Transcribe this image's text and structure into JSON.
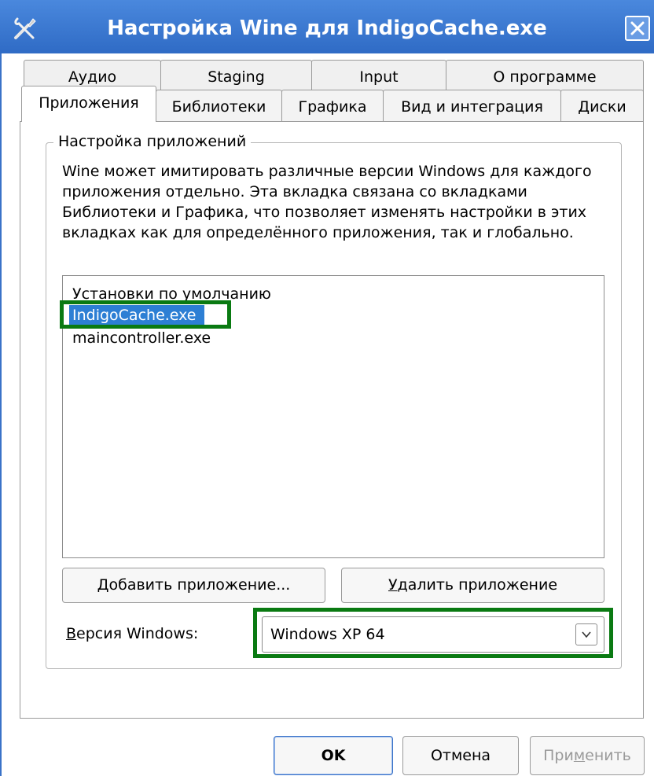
{
  "window": {
    "title": "Настройка Wine для IndigoCache.exe",
    "icon": "tools-icon"
  },
  "tabs": {
    "back_row": [
      "Аудио",
      "Staging",
      "Input",
      "О программе"
    ],
    "front_row": [
      "Приложения",
      "Библиотеки",
      "Графика",
      "Вид и интеграция",
      "Диски"
    ],
    "active": "Приложения"
  },
  "group": {
    "title": "Настройка приложений",
    "description": "Wine может имитировать различные версии Windows для каждого приложения отдельно. Эта вкладка связана со вкладками Библиотеки и Графика, что позволяет изменять настройки в этих вкладках как для определённого приложения, так и глобально."
  },
  "app_list": {
    "items": [
      "Установки по умолчанию",
      "IndigoCache.exe",
      "maincontroller.exe"
    ],
    "selected": "IndigoCache.exe"
  },
  "buttons": {
    "add_mnemonic": "Д",
    "add_rest": "обавить приложение...",
    "remove_mnemonic": "У",
    "remove_rest": "далить приложение"
  },
  "windows_version": {
    "label_mnemonic": "В",
    "label_rest": "ерсия Windows:",
    "value": "Windows XP 64"
  },
  "dialog_buttons": {
    "ok": "OK",
    "cancel": "Отмена",
    "apply_pre": "При",
    "apply_mnemonic": "м",
    "apply_post": "енить"
  },
  "colors": {
    "titlebar": "#2f6bc5",
    "selection": "#2d7fd4",
    "highlight_box": "#0a7a12"
  }
}
